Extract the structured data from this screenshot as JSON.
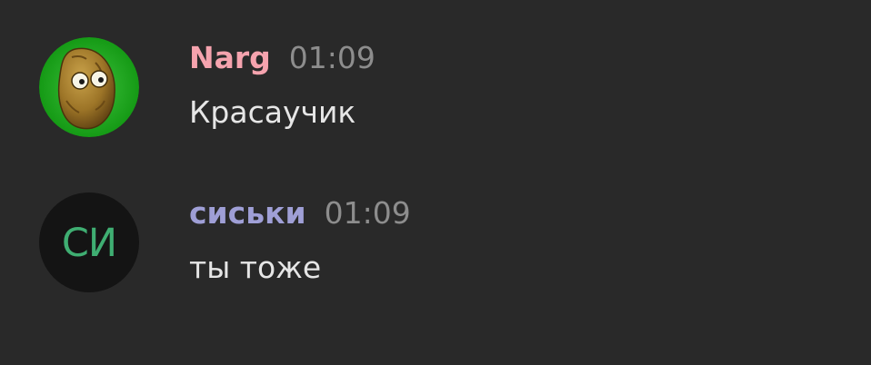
{
  "messages": [
    {
      "author": "Narg",
      "author_color": "#f5a3ae",
      "time": "01:09",
      "text": "Красаучик",
      "avatar": {
        "type": "image",
        "icon": "walnut-icon",
        "background": "#1fa31f"
      }
    },
    {
      "author": "сиськи",
      "author_color": "#9f9fd6",
      "time": "01:09",
      "text": "ты тоже",
      "avatar": {
        "type": "initials",
        "initials": "СИ",
        "color": "#3fae72",
        "background": "#141414"
      }
    }
  ]
}
